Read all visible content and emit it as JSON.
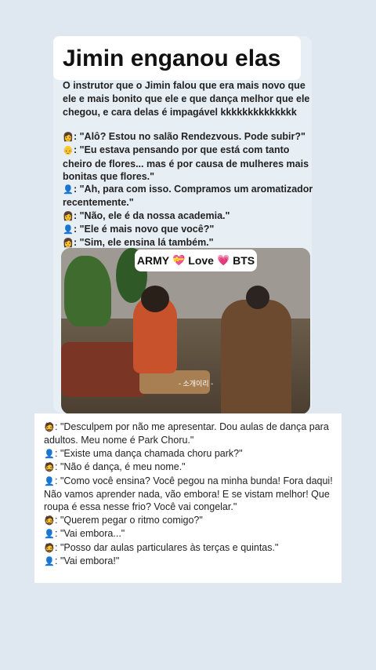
{
  "title": "Jimin enganou elas",
  "intro": "O instrutor que o Jimin falou que era mais novo que ele e mais bonito que ele e que dança melhor que ele chegou, e cara delas é impagável kkkkkkkkkkkkkk",
  "dialog_top": [
    {
      "icon": "person-blonde-emoji",
      "glyph": "👩",
      "text": ": \"Alô? Estou no salão Rendezvous. Pode subir?\""
    },
    {
      "icon": "older-man-emoji",
      "glyph": "👴",
      "text": ": \"Eu estava pensando por que está com tanto cheiro de flores... mas é por causa de mulheres mais bonitas que flores.\""
    },
    {
      "icon": "bust-silhouette-emoji",
      "glyph": "👤",
      "text": ": \"Ah, para com isso. Compramos um aromatizador recentemente.\""
    },
    {
      "icon": "person-blonde-emoji",
      "glyph": "👩",
      "text": ": \"Não, ele é da nossa academia.\""
    },
    {
      "icon": "bust-silhouette-emoji",
      "glyph": "👤",
      "text": ": \"Ele é mais novo que você?\""
    },
    {
      "icon": "person-blonde-emoji",
      "glyph": "👩",
      "text": ": \"Sim, ele ensina lá também.\""
    }
  ],
  "video": {
    "badge_army": "ARMY",
    "badge_love": "Love",
    "badge_bts": "BTS",
    "subtitle": "- 소개이리 -"
  },
  "dialog_bottom": [
    {
      "icon": "man-face-emoji",
      "glyph": "🧔",
      "text": ": \"Desculpem por não me apresentar. Dou aulas de dança para adultos. Meu nome é Park Choru.\""
    },
    {
      "icon": "bust-silhouette-emoji",
      "glyph": "👤",
      "text": ": \"Existe uma dança chamada choru park?\""
    },
    {
      "icon": "man-face-emoji",
      "glyph": "🧔",
      "text": ": \"Não é dança, é meu nome.\""
    },
    {
      "icon": "bust-silhouette-emoji",
      "glyph": "👤",
      "text": ": \"Como você ensina? Você pegou na minha bunda! Fora daqui! Não vamos aprender nada, vão embora! E se vistam melhor! Que roupa é essa nesse frio? Você vai congelar.\""
    },
    {
      "icon": "man-face-emoji",
      "glyph": "🧔",
      "text": ": \"Querem pegar o ritmo comigo?\""
    },
    {
      "icon": "bust-silhouette-emoji",
      "glyph": "👤",
      "text": ": \"Vai embora...\""
    },
    {
      "icon": "man-face-emoji",
      "glyph": "🧔",
      "text": ": \"Posso dar aulas particulares às terças e quintas.\""
    },
    {
      "icon": "bust-silhouette-emoji",
      "glyph": "👤",
      "text": ": \"Vai embora!\""
    }
  ],
  "colors": {
    "background": "#dfe8f0",
    "heart": "#e0409a",
    "card": "#e7eef4"
  }
}
